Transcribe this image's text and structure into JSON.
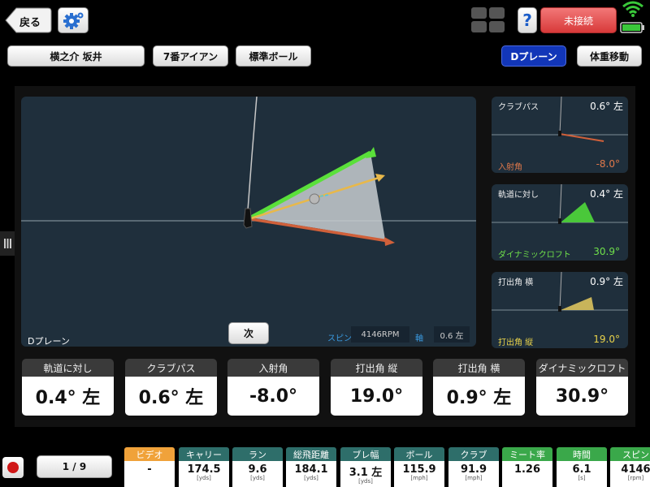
{
  "header": {
    "back_label": "戻る",
    "connection_label": "未接続",
    "help_label": "?"
  },
  "selectors": {
    "player": "横之介 坂井",
    "club": "7番アイアン",
    "ball": "標準ボール",
    "view_active": "Dプレーン",
    "view_other": "体重移動"
  },
  "main_view": {
    "label": "Dプレーン",
    "next_label": "次",
    "spin_label": "スピン",
    "spin_value": "4146RPM",
    "axis_label": "軸",
    "axis_value": "0.6 左"
  },
  "side_panels": [
    {
      "top_label": "クラブパス",
      "top_value": "0.6° 左",
      "bottom_label": "入射角",
      "bottom_value": "-8.0°",
      "bottom_color": "#e0784a"
    },
    {
      "top_label": "軌道に対し",
      "top_value": "0.4° 左",
      "bottom_label": "ダイナミックロフト",
      "bottom_value": "30.9°",
      "bottom_color": "#6fe04a"
    },
    {
      "top_label": "打出角 横",
      "top_value": "0.9° 左",
      "bottom_label": "打出角 縦",
      "bottom_value": "19.0°",
      "bottom_color": "#e8d24a"
    }
  ],
  "metrics": [
    {
      "label": "軌道に対し",
      "value": "0.4° 左"
    },
    {
      "label": "クラブパス",
      "value": "0.6° 左"
    },
    {
      "label": "入射角",
      "value": "-8.0°"
    },
    {
      "label": "打出角 縦",
      "value": "19.0°"
    },
    {
      "label": "打出角 横",
      "value": "0.9° 左"
    },
    {
      "label": "ダイナミックロフト",
      "value": "30.9°"
    }
  ],
  "footer": {
    "shot_counter": "1 / 9",
    "stats": [
      {
        "label": "ビデオ",
        "value": "-",
        "unit": "",
        "color": "#f0a23a"
      },
      {
        "label": "キャリー",
        "value": "174.5",
        "unit": "[yds]",
        "color": "#2e6e6a"
      },
      {
        "label": "ラン",
        "value": "9.6",
        "unit": "[yds]",
        "color": "#2e6e6a"
      },
      {
        "label": "総飛距離",
        "value": "184.1",
        "unit": "[yds]",
        "color": "#2e6e6a"
      },
      {
        "label": "ブレ幅",
        "value": "3.1 左",
        "unit": "[yds]",
        "color": "#2e6e6a"
      },
      {
        "label": "ボール",
        "value": "115.9",
        "unit": "[mph]",
        "color": "#2e6e6a"
      },
      {
        "label": "クラブ",
        "value": "91.9",
        "unit": "[mph]",
        "color": "#2e6e6a"
      },
      {
        "label": "ミート率",
        "value": "1.26",
        "unit": "",
        "color": "#3aa84a"
      },
      {
        "label": "時間",
        "value": "6.1",
        "unit": "[s]",
        "color": "#3aa84a"
      },
      {
        "label": "スピン",
        "value": "4146",
        "unit": "[rpm]",
        "color": "#3aa84a"
      }
    ]
  },
  "colors": {
    "panel_bg": "#1f2f3c",
    "accent_blue": "#1236b8",
    "disconnected_red": "#e84b4b",
    "face_green": "#5ae03a",
    "path_orange": "#d0603a",
    "ball_yellow": "#e8b84a"
  }
}
